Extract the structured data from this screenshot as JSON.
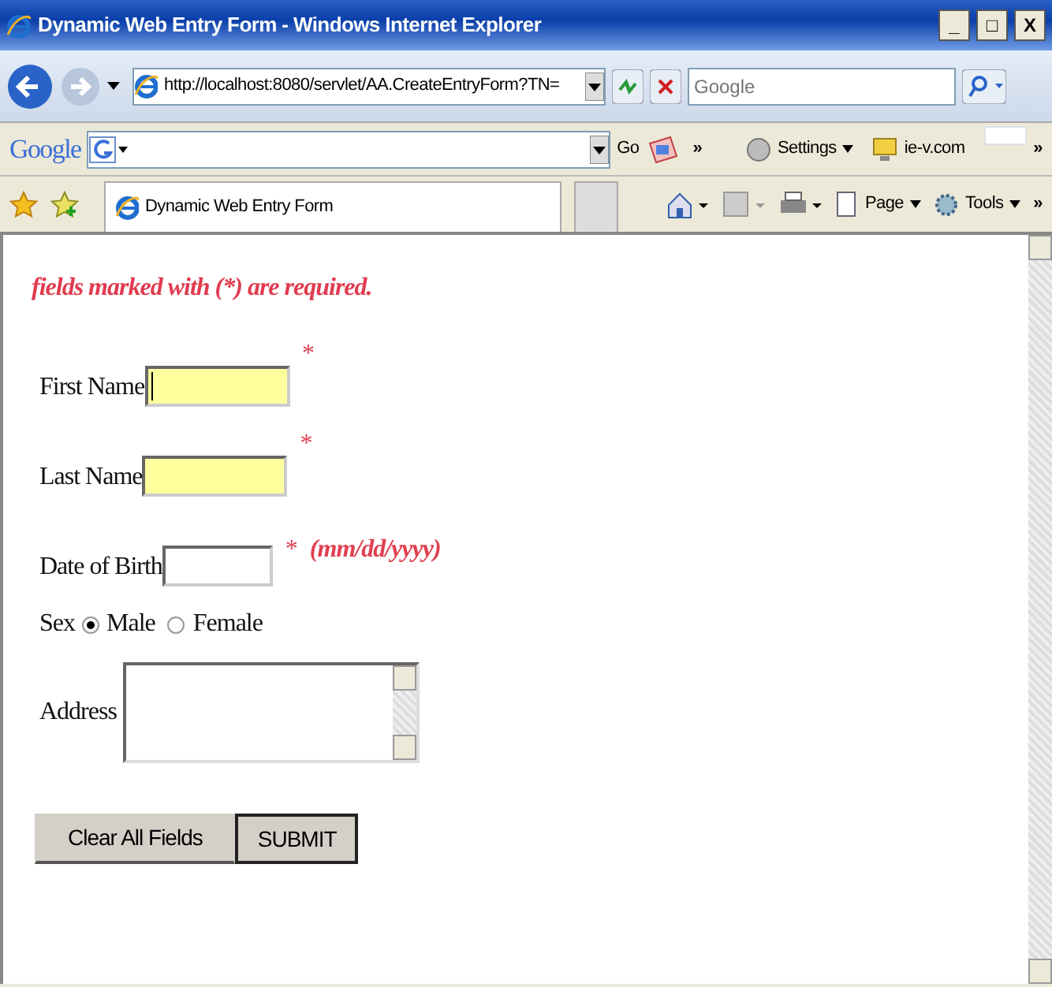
{
  "window": {
    "title": "Dynamic Web Entry Form - Windows Internet Explorer",
    "controls": [
      "_",
      "□",
      "X"
    ]
  },
  "address_bar": {
    "url": "http://localhost:8080/servlet/AA.CreateEntryForm?TN=",
    "search_placeholder": "Google"
  },
  "google_toolbar": {
    "logo": "Google",
    "go": "Go",
    "more": "»",
    "settings": "Settings",
    "site": "ie-v.com",
    "overflow": "»"
  },
  "tabs": [
    {
      "title": "Dynamic Web Entry Form",
      "selected": true
    }
  ],
  "command_bar": {
    "page": "Page",
    "tools": "Tools",
    "overflow": "»"
  },
  "form": {
    "note": "fields marked with (*) are required.",
    "fields": [
      {
        "kind": "text",
        "label": "First Name",
        "required_mark": "*",
        "highlighted": true,
        "focused": true
      },
      {
        "kind": "text",
        "label": "Last Name",
        "required_mark": "*",
        "highlighted": true,
        "focused": false
      },
      {
        "kind": "text",
        "label": "Date of Birth",
        "required_mark": "*",
        "hint": "(mm/dd/yyyy)",
        "highlighted": false,
        "focused": false
      },
      {
        "kind": "radio",
        "label": "Sex",
        "options": [
          {
            "label": "Male",
            "selected": true
          },
          {
            "label": "Female",
            "selected": false
          }
        ]
      },
      {
        "kind": "textarea",
        "label": "Address"
      }
    ],
    "buttons": [
      {
        "label": "Clear All Fields",
        "kind": "flat"
      },
      {
        "label": "SUBMIT",
        "kind": "default"
      }
    ]
  }
}
